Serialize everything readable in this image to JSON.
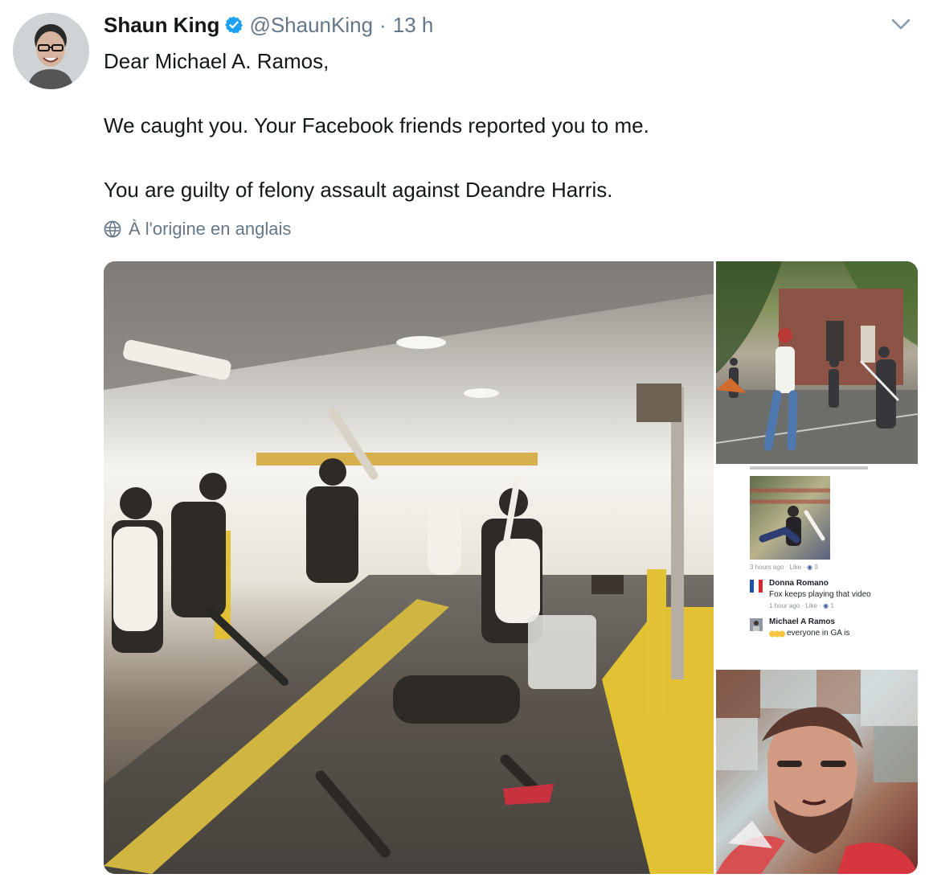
{
  "tweet": {
    "author_name": "Shaun King",
    "handle": "@ShaunKing",
    "separator": "·",
    "time": "13 h",
    "text_lines": [
      "Dear Michael A. Ramos,",
      "",
      "We caught you. Your Facebook friends reported you to me.",
      "",
      "You are guilty of felony assault against Deandre Harris."
    ],
    "translation_label": "À l'origine en anglais"
  },
  "media": {
    "facebook_screenshot": {
      "first_meta": "3 hours ago · Like ·",
      "first_reactions": "9",
      "comments": [
        {
          "name": "Donna Romano",
          "text": "Fox keeps playing that video",
          "meta": "1 hour ago · Like ·",
          "reactions": "1"
        },
        {
          "name": "Michael A Ramos",
          "text": "everyone in GA is"
        }
      ]
    }
  },
  "icons": {
    "avatar": "avatar",
    "verified": "verified-badge-icon",
    "menu": "chevron-down-icon",
    "translation": "globe-icon"
  },
  "colors": {
    "primary_text": "#14171a",
    "secondary_text": "#657786",
    "verified_blue": "#1da1f2",
    "background": "#ffffff"
  }
}
